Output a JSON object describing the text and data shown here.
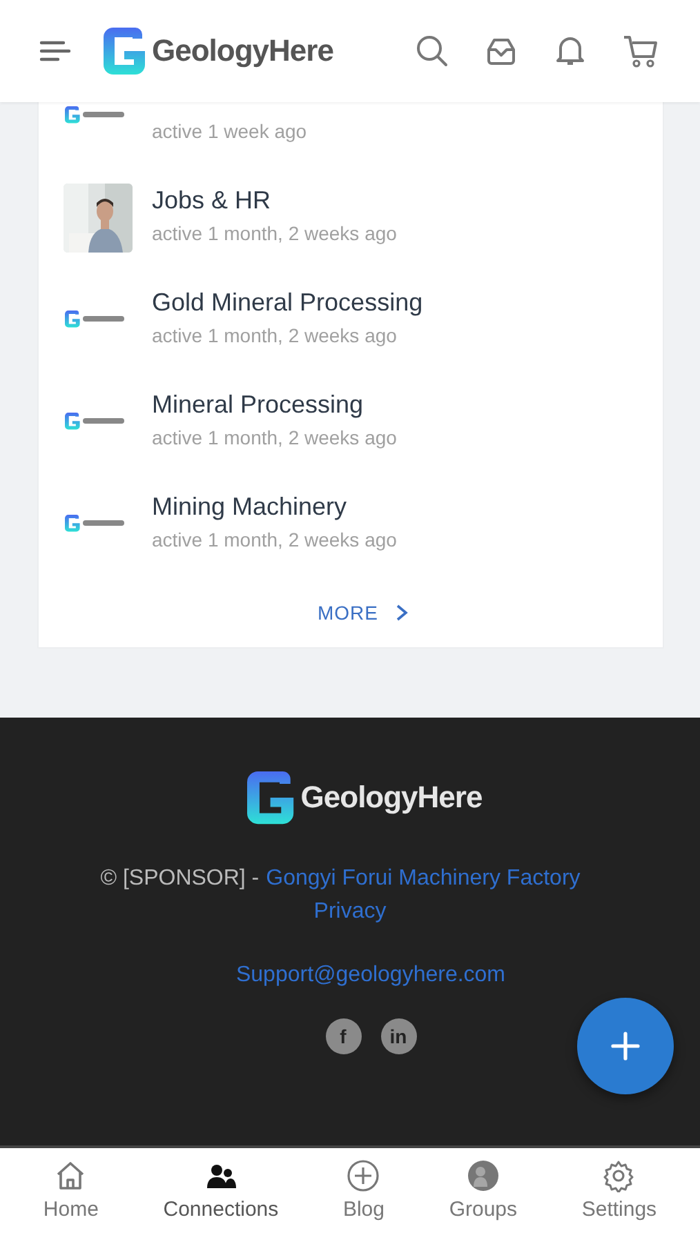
{
  "header": {
    "brand": "GeologyHere"
  },
  "groups": [
    {
      "kind": "logo",
      "activity": "active 1 week ago"
    },
    {
      "kind": "picture",
      "title": "Jobs & HR",
      "activity": "active 1 month, 2 weeks ago"
    },
    {
      "kind": "logo",
      "title": "Gold Mineral Processing",
      "activity": "active 1 month, 2 weeks ago"
    },
    {
      "kind": "logo",
      "title": "Mineral Processing",
      "activity": "active 1 month, 2 weeks ago"
    },
    {
      "kind": "logo",
      "title": "Mining Machinery",
      "activity": "active 1 month, 2 weeks ago"
    }
  ],
  "more": "MORE",
  "footer": {
    "brand": "GeologyHere",
    "copyright": "© [SPONSOR] -",
    "sponsor": "Gongyi Forui Machinery Factory",
    "privacy": "Privacy",
    "email": "Support@geologyhere.com",
    "social": [
      {
        "glyph": "f"
      },
      {
        "glyph": "in"
      }
    ]
  },
  "nav": [
    {
      "kind": "home",
      "label": "Home",
      "selected": false
    },
    {
      "kind": "people",
      "label": "Connections",
      "selected": true
    },
    {
      "kind": "plus",
      "label": "Blog",
      "selected": false
    },
    {
      "kind": "groups",
      "label": "Groups",
      "selected": false
    },
    {
      "kind": "gear",
      "label": "Settings",
      "selected": false
    }
  ]
}
